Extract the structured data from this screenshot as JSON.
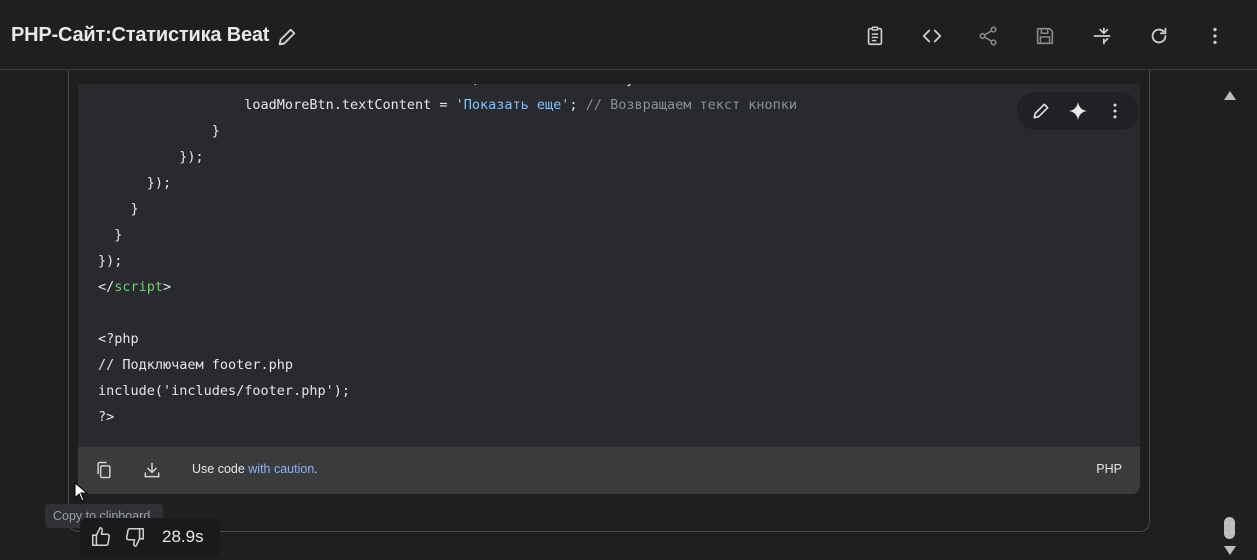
{
  "header": {
    "title": "PHP-Сайт:Статистика Beat",
    "icons": [
      "pencil-icon",
      "clipboard-icon",
      "code-icon",
      "share-icon",
      "save-icon",
      "collapse-icon",
      "refresh-icon",
      "more-vert-icon"
    ]
  },
  "code": {
    "lines": [
      [
        {
          "t": "                  loadMoreBtn.disabled = false; // Включаем кнопку",
          "c": ""
        }
      ],
      [
        {
          "t": "                  loadMoreBtn.textContent = ",
          "c": ""
        },
        {
          "t": "'Показать еще'",
          "c": "str"
        },
        {
          "t": "; ",
          "c": ""
        },
        {
          "t": "// Возвращаем текст кнопки",
          "c": "com"
        }
      ],
      [
        {
          "t": "              }",
          "c": ""
        }
      ],
      [
        {
          "t": "          });",
          "c": ""
        }
      ],
      [
        {
          "t": "      });",
          "c": ""
        }
      ],
      [
        {
          "t": "    }",
          "c": ""
        }
      ],
      [
        {
          "t": "  }",
          "c": ""
        }
      ],
      [
        {
          "t": "});",
          "c": ""
        }
      ],
      [
        {
          "t": "</",
          "c": ""
        },
        {
          "t": "script",
          "c": "tag"
        },
        {
          "t": ">",
          "c": ""
        }
      ],
      [
        {
          "t": "",
          "c": ""
        }
      ],
      [
        {
          "t": "<?php",
          "c": ""
        }
      ],
      [
        {
          "t": "// Подключаем footer.php",
          "c": ""
        }
      ],
      [
        {
          "t": "include('includes/footer.php');",
          "c": ""
        }
      ],
      [
        {
          "t": "?>",
          "c": ""
        }
      ]
    ]
  },
  "code_footer": {
    "prefix": "Use code ",
    "link": "with caution",
    "suffix": ".",
    "language": "PHP"
  },
  "tooltip": "Copy to clipboard",
  "feedback": {
    "time": "28.9s"
  },
  "colors": {
    "background": "#1f1f1f",
    "code_bg": "#282a2e",
    "string": "#7dc3ff",
    "comment": "#8a9199",
    "tag": "#6fcf6f",
    "link": "#8ab4f8"
  }
}
